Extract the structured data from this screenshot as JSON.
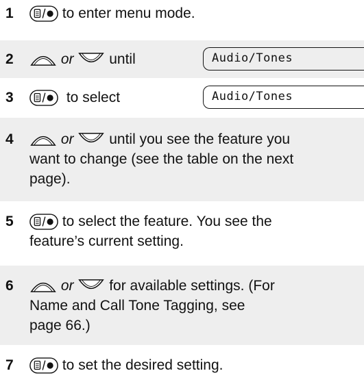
{
  "steps": [
    {
      "number": "1",
      "text": "to enter menu mode."
    },
    {
      "number": "2",
      "or": "or",
      "text": "until",
      "display": "Audio/Tones"
    },
    {
      "number": "3",
      "text": "to select",
      "display": "Audio/Tones"
    },
    {
      "number": "4",
      "or": "or",
      "text": "until you see the feature you",
      "text2": "want to change (see the table on the next",
      "text3": "page)."
    },
    {
      "number": "5",
      "text": "to select the feature. You see the",
      "text2": "feature’s current setting."
    },
    {
      "number": "6",
      "or": "or",
      "text": "for available settings. (For",
      "text2": "Name and Call Tone Tagging, see",
      "text3": "page 66.)"
    },
    {
      "number": "7",
      "text": "to set the desired setting."
    }
  ],
  "icons": {
    "menu_key": "menu-select-key-icon",
    "scroll_up": "scroll-up-icon",
    "scroll_down": "scroll-down-icon"
  },
  "colors": {
    "shade": "#eeeeee",
    "text": "#111111"
  }
}
